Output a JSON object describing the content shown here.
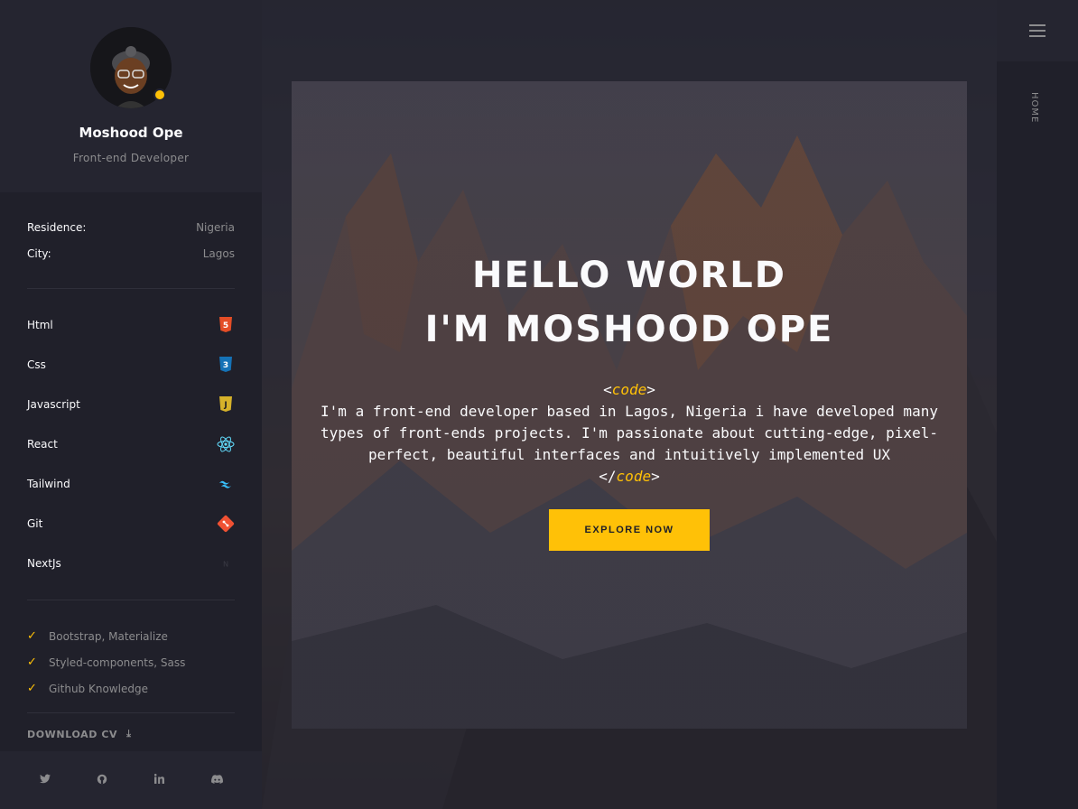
{
  "profile": {
    "name": "Moshood Ope",
    "role": "Front-end Developer"
  },
  "info": [
    {
      "key": "Residence:",
      "value": "Nigeria"
    },
    {
      "key": "City:",
      "value": "Lagos"
    }
  ],
  "skills": [
    {
      "label": "Html",
      "icon": "html5-icon"
    },
    {
      "label": "Css",
      "icon": "css3-icon"
    },
    {
      "label": "Javascript",
      "icon": "javascript-icon"
    },
    {
      "label": "React",
      "icon": "react-icon"
    },
    {
      "label": "Tailwind",
      "icon": "tailwind-icon"
    },
    {
      "label": "Git",
      "icon": "git-icon"
    },
    {
      "label": "NextJs",
      "icon": "nextjs-icon"
    }
  ],
  "extras": [
    "Bootstrap, Materialize",
    "Styled-components, Sass",
    "Github Knowledge"
  ],
  "download": {
    "label": "DOWNLOAD CV"
  },
  "nav": {
    "home": "HOME"
  },
  "hero": {
    "line1": "HELLO WORLD",
    "line2": "I'M MOSHOOD OPE",
    "code_open": "<",
    "code_word": "code",
    "code_close": ">",
    "code_end_open": "</",
    "text": "I'm a front-end developer based in Lagos, Nigeria i have developed many types of front-ends projects. I'm passionate about cutting-edge, pixel-perfect, beautiful interfaces and intuitively implemented UX",
    "button": "EXPLORE NOW"
  },
  "social": [
    "twitter-icon",
    "github-icon",
    "linkedin-icon",
    "discord-icon"
  ],
  "colors": {
    "accent": "#ffc107",
    "sidebar": "#20202a",
    "panel": "#252530",
    "muted": "#8c8c8e"
  }
}
